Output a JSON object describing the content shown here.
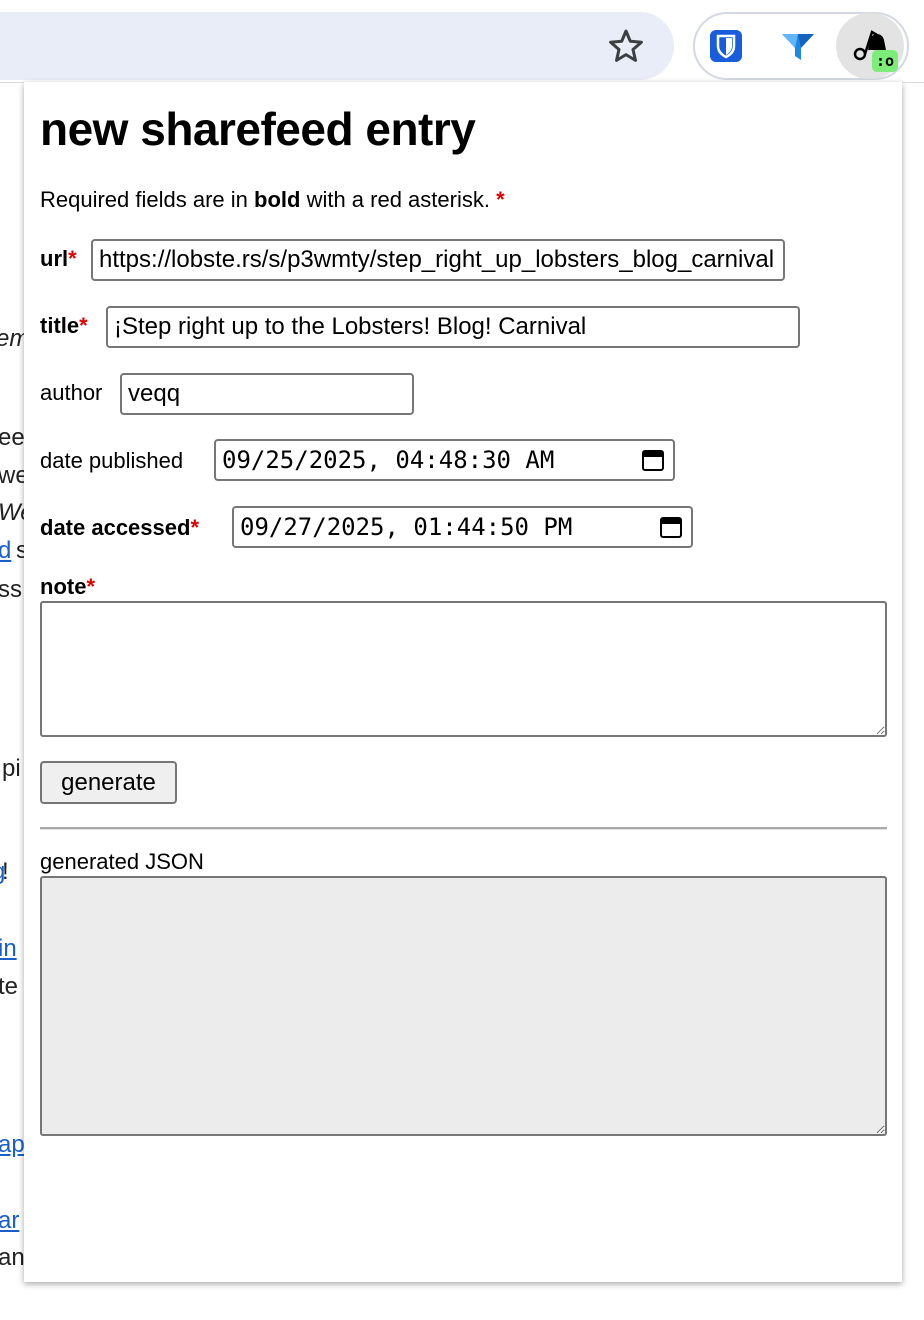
{
  "extensions": {
    "star": "bookmark-star-icon",
    "bitwarden": "bitwarden-shield-icon",
    "funnel": "funnel-icon",
    "active": "sharefeed-icon",
    "badge": ":o"
  },
  "background_fragments": [
    {
      "text": "em",
      "style": "ital"
    },
    {
      "text": "ee",
      "style": "plain"
    },
    {
      "text": "we",
      "style": "plain"
    },
    {
      "text": "We",
      "style": "ital"
    },
    {
      "text": "d",
      "style": "link"
    },
    {
      "text": "s",
      "style": "plain"
    },
    {
      "text": "ss",
      "style": "plain"
    },
    {
      "text": "pi",
      "style": "plain"
    },
    {
      "text": "g",
      "style": "link"
    },
    {
      "text": "!",
      "style": "plain"
    },
    {
      "text": "in",
      "style": "link"
    },
    {
      "text": "te",
      "style": "plain"
    },
    {
      "text": "ap",
      "style": "link"
    },
    {
      "text": "ar",
      "style": "link"
    },
    {
      "text": "an",
      "style": "plain"
    }
  ],
  "popup": {
    "title": "new sharefeed entry",
    "intro": {
      "before": "Required fields are in ",
      "bold": "bold",
      "after": " with a red asterisk. ",
      "asterisk": "*"
    },
    "fields": {
      "url": {
        "label": "url",
        "value": "https://lobste.rs/s/p3wmty/step_right_up_lobsters_blog_carnival"
      },
      "title": {
        "label": "title",
        "value": "¡Step right up to the Lobsters! Blog! Carnival"
      },
      "author": {
        "label": "author",
        "value": "veqq"
      },
      "date_published": {
        "label": "date published",
        "value": "09/25/2025, 04:48:30 AM"
      },
      "date_accessed": {
        "label": "date accessed",
        "value": "09/27/2025, 01:44:50 PM"
      },
      "note": {
        "label": "note",
        "value": ""
      }
    },
    "asterisk": "*",
    "generate_label": "generate",
    "output_label": "generated JSON",
    "output_value": ""
  },
  "colors": {
    "required_asterisk": "#e00000",
    "badge": "#7ded7a",
    "omnibox": "#e9edf7",
    "link": "#1a5fc7"
  }
}
